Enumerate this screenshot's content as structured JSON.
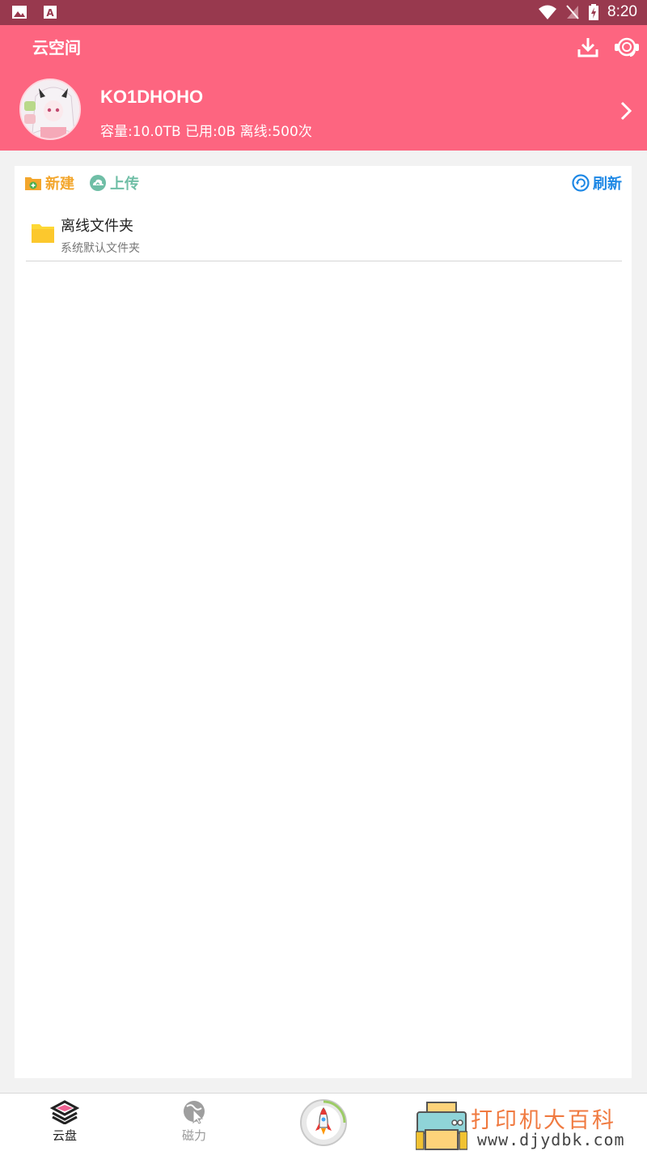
{
  "status_bar": {
    "time": "8:20"
  },
  "header": {
    "title": "云空间",
    "username": "KO1DHOHO",
    "stats": "容量:10.0TB 已用:0B 离线:500次"
  },
  "toolbar": {
    "new_label": "新建",
    "upload_label": "上传",
    "refresh_label": "刷新"
  },
  "files": [
    {
      "name": "离线文件夹",
      "description": "系统默认文件夹"
    }
  ],
  "bottom_nav": {
    "items": [
      {
        "label": "云盘",
        "active": true
      },
      {
        "label": "磁力",
        "active": false
      }
    ]
  },
  "watermark": {
    "line1": "打印机大百科",
    "line2": "www.djydbk.com"
  },
  "colors": {
    "status_bar": "#98394e",
    "header": "#fd6580",
    "new_accent": "#f3a62c",
    "upload_accent": "#6fbea6",
    "refresh_accent": "#1e88e5",
    "folder": "#fdd835"
  }
}
